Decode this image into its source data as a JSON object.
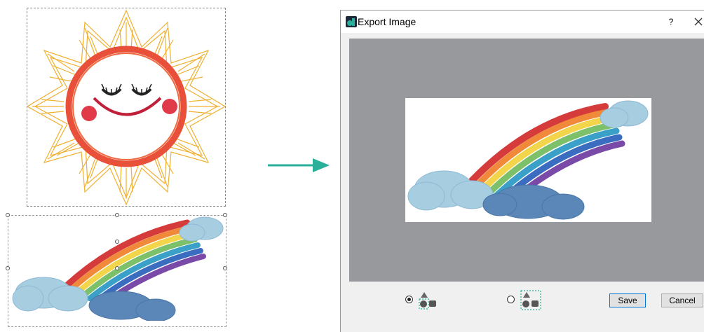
{
  "dialog": {
    "title": "Export Image",
    "help_label": "?",
    "save_label": "Save",
    "cancel_label": "Cancel",
    "options": [
      {
        "name": "export-selected-option",
        "selected": true
      },
      {
        "name": "export-all-option",
        "selected": false
      }
    ]
  },
  "colors": {
    "preview_background": "#98999c",
    "arrow": "#2aaf9a",
    "sun_rays": "#f0b030",
    "sun_face": "#e9503a",
    "cheeks": "#e13a48",
    "accent_dashed": "#2aaf9a"
  },
  "icons": {
    "app": "app-logo-icon",
    "close": "close-icon",
    "shapes": "shapes-icon"
  }
}
